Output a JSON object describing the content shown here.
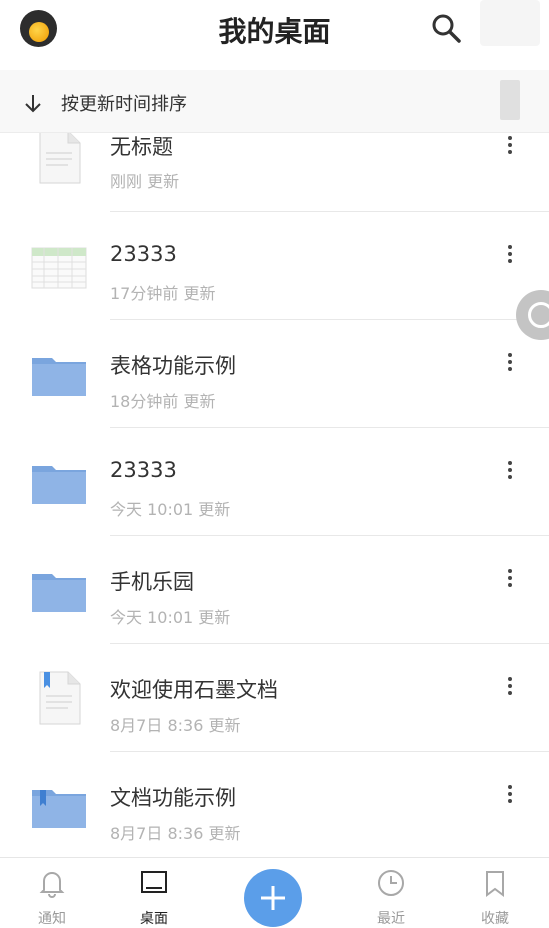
{
  "header": {
    "title": "我的桌面",
    "avatar_icon": "user-avatar",
    "search_icon": "search-icon"
  },
  "sort": {
    "label": "按更新时间排序",
    "icon": "arrow-down-icon"
  },
  "files": [
    {
      "name": "无标题",
      "meta": "刚刚  更新",
      "type": "document"
    },
    {
      "name": "23333",
      "meta": "17分钟前  更新",
      "type": "spreadsheet"
    },
    {
      "name": "表格功能示例",
      "meta": "18分钟前  更新",
      "type": "folder"
    },
    {
      "name": "23333",
      "meta": "今天 10:01  更新",
      "type": "folder"
    },
    {
      "name": "手机乐园",
      "meta": "今天 10:01  更新",
      "type": "folder"
    },
    {
      "name": "欢迎使用石墨文档",
      "meta": "8月7日 8:36  更新",
      "type": "document-bookmarked"
    },
    {
      "name": "文档功能示例",
      "meta": "8月7日 8:36  更新",
      "type": "folder-bookmarked"
    }
  ],
  "tabs": [
    {
      "label": "通知",
      "icon": "bell-icon",
      "active": false
    },
    {
      "label": "桌面",
      "icon": "desktop-icon",
      "active": true
    },
    {
      "label": "最近",
      "icon": "clock-icon",
      "active": false
    },
    {
      "label": "收藏",
      "icon": "bookmark-icon",
      "active": false
    }
  ],
  "colors": {
    "accent": "#5b9ee9",
    "folder": "#8fb4e6",
    "folder_tab": "#7aa5de"
  }
}
